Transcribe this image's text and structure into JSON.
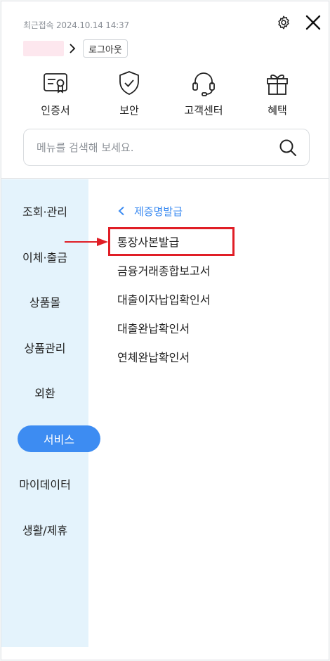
{
  "header": {
    "last_login": "최근접속 2024.10.14 14:37",
    "logout_label": "로그아웃",
    "quick_menu": [
      {
        "label": "인증서",
        "icon": "certificate-icon"
      },
      {
        "label": "보안",
        "icon": "shield-check-icon"
      },
      {
        "label": "고객센터",
        "icon": "headset-icon"
      },
      {
        "label": "혜택",
        "icon": "gift-icon"
      }
    ]
  },
  "search": {
    "placeholder": "메뉴를 검색해 보세요."
  },
  "sidebar": {
    "items": [
      {
        "label": "조회·관리"
      },
      {
        "label": "이체·출금"
      },
      {
        "label": "상품몰"
      },
      {
        "label": "상품관리"
      },
      {
        "label": "외환"
      },
      {
        "label": "서비스",
        "active": true
      },
      {
        "label": "마이데이터"
      },
      {
        "label": "생활/제휴"
      }
    ]
  },
  "content": {
    "breadcrumb": "제증명발급",
    "items": [
      {
        "label": "통장사본발급",
        "highlighted": true
      },
      {
        "label": "금융거래종합보고서"
      },
      {
        "label": "대출이자납입확인서"
      },
      {
        "label": "대출완납확인서"
      },
      {
        "label": "연체완납확인서"
      }
    ]
  },
  "colors": {
    "accent": "#3d8cf2",
    "sidebar_bg": "#e4f3fc",
    "annotation_red": "#e01e26"
  }
}
